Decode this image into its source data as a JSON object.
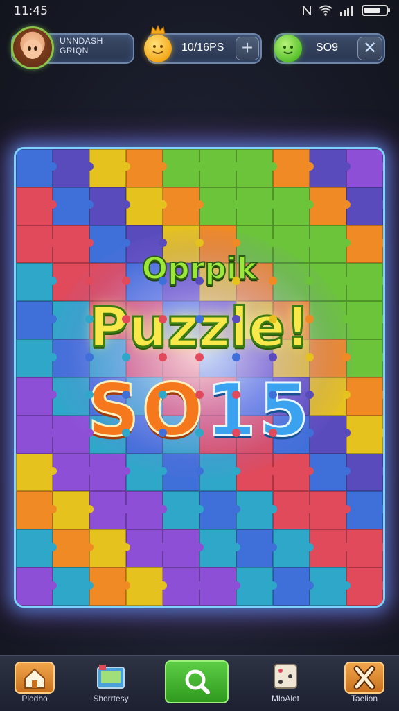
{
  "status_bar": {
    "time": "11:45"
  },
  "profile": {
    "name_line1": "UNNDASH",
    "name_line2": "GRIQN"
  },
  "coins": {
    "value": "10/16PS",
    "plus_label": "+"
  },
  "gems": {
    "value": "SO9",
    "close_label": "✕"
  },
  "banner": {
    "subtitle": "Oprpik",
    "title": "Puzzle!",
    "score_part1": "SO",
    "score_part2": "15"
  },
  "bottom_nav": [
    {
      "id": "home",
      "label": "Plodho"
    },
    {
      "id": "story",
      "label": "Shorrtesy"
    },
    {
      "id": "search",
      "label": ""
    },
    {
      "id": "match",
      "label": "MloAlot"
    },
    {
      "id": "cancel",
      "label": "Taelion"
    }
  ],
  "colors": {
    "accent_green": "#6bc43a",
    "accent_orange": "#f5781d",
    "accent_blue": "#3aa2ee",
    "board_border": "#7fd1ff"
  }
}
